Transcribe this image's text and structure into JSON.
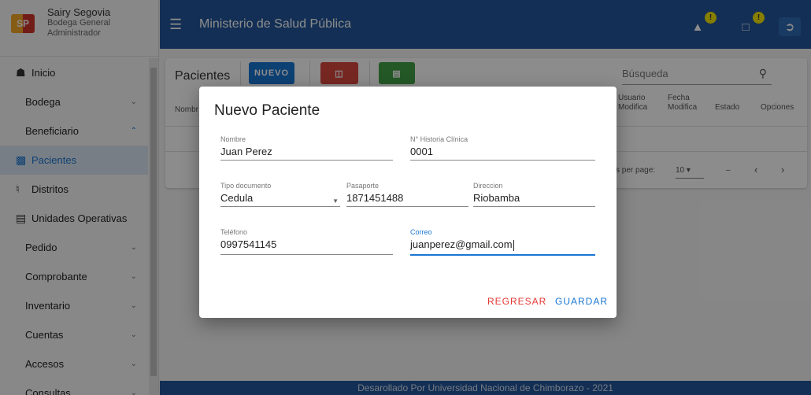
{
  "user": {
    "logo_text": "SP",
    "name": "Sairy Segovia",
    "sub1": "Bodega General",
    "sub2": "Administrador"
  },
  "sidebar": {
    "items": [
      {
        "label": "Inicio"
      },
      {
        "label": "Bodega"
      },
      {
        "label": "Beneficiario"
      },
      {
        "label": "Pacientes"
      },
      {
        "label": "Distritos"
      },
      {
        "label": "Unidades Operativas"
      },
      {
        "label": "Pedido"
      },
      {
        "label": "Comprobante"
      },
      {
        "label": "Inventario"
      },
      {
        "label": "Cuentas"
      },
      {
        "label": "Accesos"
      },
      {
        "label": "Consultas"
      }
    ]
  },
  "header": {
    "title": "Ministerio de Salud Pública",
    "badge": "!"
  },
  "main": {
    "page_title": "Pacientes",
    "new_button": "NUEVO",
    "search_placeholder": "Búsqueda",
    "columns": {
      "col0": "Nombr",
      "usuario1": "Usuario",
      "usuario2": "Modifica",
      "fecha1": "Fecha",
      "fecha2": "Modifica",
      "estado": "Estado",
      "opciones": "Opciones"
    },
    "pagination": {
      "label": "s per page:",
      "value": "10",
      "range": "–"
    }
  },
  "dialog": {
    "title": "Nuevo Paciente",
    "fields": {
      "nombre": {
        "label": "Nombre",
        "value": "Juan Perez"
      },
      "historia": {
        "label": "N° Historia Clínica",
        "value": "0001"
      },
      "tipo": {
        "label": "Tipo documento",
        "value": "Cedula"
      },
      "pasaporte": {
        "label": "Pasaporte",
        "value": "1871451488"
      },
      "direccion": {
        "label": "Direccion",
        "value": "Riobamba"
      },
      "telefono": {
        "label": "Teléfono",
        "value": "0997541145"
      },
      "correo": {
        "label": "Correo",
        "value": "juanperez@gmail.com"
      }
    },
    "cancel": "REGRESAR",
    "save": "GUARDAR"
  },
  "footer": {
    "text": "Desarollado Por Universidad Nacional de Chimborazo - 2021"
  },
  "colors": {
    "primary": "#23579b",
    "accent": "#1976d2",
    "danger": "#e53935",
    "print": "#d9473f",
    "excel": "#43a047",
    "badge": "#f5e500"
  }
}
